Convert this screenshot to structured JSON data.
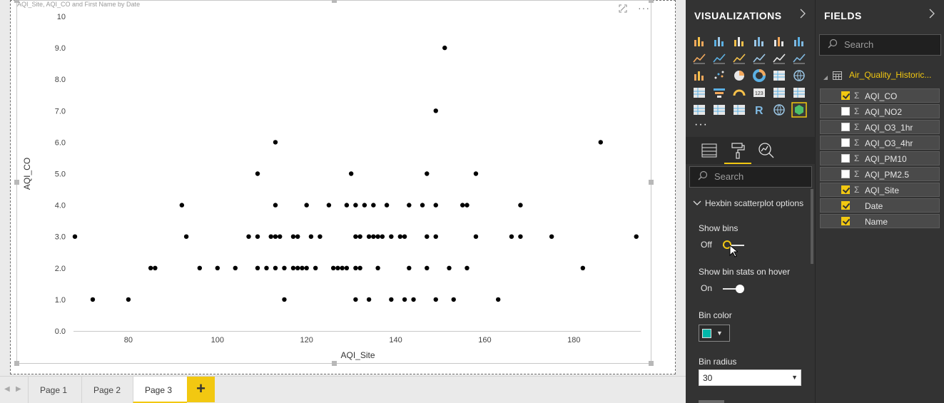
{
  "canvas": {
    "visual_title": "AQI_Site, AQI_CO and First Name by Date",
    "tools": {
      "focus_icon": "focus-mode-icon",
      "more_icon": "more-options-icon"
    }
  },
  "chart_data": {
    "type": "scatter",
    "xlabel": "AQI_Site",
    "ylabel": "AQI_CO",
    "xlim": [
      68,
      195
    ],
    "ylim": [
      0,
      10
    ],
    "x_ticks": [
      "80",
      "100",
      "120",
      "140",
      "160",
      "180"
    ],
    "x_tick_values": [
      80,
      100,
      120,
      140,
      160,
      180
    ],
    "y_ticks": [
      "0.0",
      "1.0",
      "2.0",
      "3.0",
      "4.0",
      "5.0",
      "6.0",
      "7.0",
      "8.0",
      "9.0",
      "10"
    ],
    "y_tick_values": [
      0,
      1,
      2,
      3,
      4,
      5,
      6,
      7,
      8,
      9,
      10
    ],
    "grid": false,
    "point_color": "#000000",
    "points": [
      [
        68,
        3
      ],
      [
        72,
        1
      ],
      [
        80,
        1
      ],
      [
        85,
        2
      ],
      [
        86,
        2
      ],
      [
        92,
        4
      ],
      [
        93,
        3
      ],
      [
        96,
        2
      ],
      [
        100,
        2
      ],
      [
        104,
        2
      ],
      [
        107,
        3
      ],
      [
        109,
        5
      ],
      [
        109,
        3
      ],
      [
        109,
        2
      ],
      [
        111,
        2
      ],
      [
        112,
        3
      ],
      [
        113,
        6
      ],
      [
        113,
        4
      ],
      [
        113,
        3
      ],
      [
        113,
        2
      ],
      [
        114,
        3
      ],
      [
        115,
        2
      ],
      [
        115,
        1
      ],
      [
        117,
        3
      ],
      [
        117,
        2
      ],
      [
        118,
        3
      ],
      [
        118,
        2
      ],
      [
        119,
        2
      ],
      [
        120,
        4
      ],
      [
        120,
        2
      ],
      [
        121,
        3
      ],
      [
        122,
        2
      ],
      [
        123,
        3
      ],
      [
        125,
        4
      ],
      [
        126,
        2
      ],
      [
        127,
        2
      ],
      [
        128,
        2
      ],
      [
        129,
        4
      ],
      [
        129,
        2
      ],
      [
        130,
        5
      ],
      [
        131,
        4
      ],
      [
        131,
        3
      ],
      [
        131,
        2
      ],
      [
        131,
        1
      ],
      [
        132,
        3
      ],
      [
        132,
        2
      ],
      [
        133,
        4
      ],
      [
        134,
        3
      ],
      [
        134,
        1
      ],
      [
        135,
        4
      ],
      [
        135,
        3
      ],
      [
        136,
        3
      ],
      [
        136,
        2
      ],
      [
        137,
        3
      ],
      [
        138,
        4
      ],
      [
        139,
        3
      ],
      [
        139,
        1
      ],
      [
        141,
        3
      ],
      [
        142,
        3
      ],
      [
        142,
        1
      ],
      [
        143,
        4
      ],
      [
        143,
        2
      ],
      [
        144,
        1
      ],
      [
        146,
        4
      ],
      [
        147,
        5
      ],
      [
        147,
        3
      ],
      [
        147,
        2
      ],
      [
        149,
        7
      ],
      [
        149,
        4
      ],
      [
        149,
        3
      ],
      [
        149,
        1
      ],
      [
        151,
        9
      ],
      [
        152,
        2
      ],
      [
        153,
        1
      ],
      [
        155,
        4
      ],
      [
        156,
        4
      ],
      [
        156,
        2
      ],
      [
        158,
        5
      ],
      [
        158,
        3
      ],
      [
        163,
        1
      ],
      [
        166,
        3
      ],
      [
        168,
        4
      ],
      [
        168,
        3
      ],
      [
        175,
        3
      ],
      [
        182,
        2
      ],
      [
        186,
        6
      ],
      [
        194,
        3
      ]
    ]
  },
  "pages": {
    "tabs": [
      "Page 1",
      "Page 2",
      "Page 3"
    ],
    "active": "Page 3",
    "add_label": "+"
  },
  "viz_pane": {
    "title": "VISUALIZATIONS",
    "more": "···",
    "search_placeholder": "Search",
    "section": "Hexbin scatterplot options",
    "show_bins_label": "Show bins",
    "show_bins_value": "Off",
    "show_bins_stats_label": "Show bin stats on hover",
    "show_bins_stats_value": "On",
    "bin_color_label": "Bin color",
    "bin_color": "#01b8aa",
    "bin_radius_label": "Bin radius",
    "bin_radius_value": "30"
  },
  "fields_pane": {
    "title": "FIELDS",
    "search_placeholder": "Search",
    "table_name": "Air_Quality_Historic...",
    "fields": [
      {
        "name": "AQI_CO",
        "checked": true,
        "sigma": true
      },
      {
        "name": "AQI_NO2",
        "checked": false,
        "sigma": true
      },
      {
        "name": "AQI_O3_1hr",
        "checked": false,
        "sigma": true
      },
      {
        "name": "AQI_O3_4hr",
        "checked": false,
        "sigma": true
      },
      {
        "name": "AQI_PM10",
        "checked": false,
        "sigma": true
      },
      {
        "name": "AQI_PM2.5",
        "checked": false,
        "sigma": true
      },
      {
        "name": "AQI_Site",
        "checked": true,
        "sigma": true
      },
      {
        "name": "Date",
        "checked": true,
        "sigma": false
      },
      {
        "name": "Name",
        "checked": true,
        "sigma": false
      }
    ]
  },
  "colors": {
    "accent": "#f2c811",
    "pane_bg": "#333333"
  }
}
